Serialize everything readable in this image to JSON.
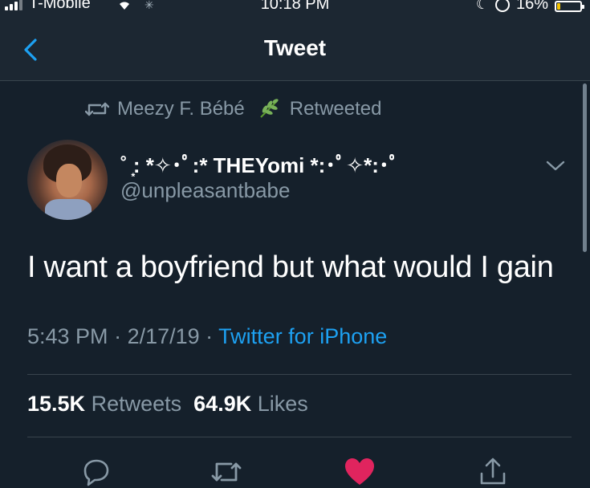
{
  "status_bar": {
    "carrier": "T-Mobile",
    "time": "10:18 PM",
    "battery": "16%",
    "battery_level": 0.16,
    "icons": [
      "signal-icon",
      "wifi-icon",
      "activity-spinner-icon",
      "moon-icon",
      "rotation-lock-icon",
      "battery-icon"
    ]
  },
  "nav": {
    "title": "Tweet",
    "back_icon": "chevron-left-icon"
  },
  "retweet_context": {
    "name": "Meezy F. Bébé",
    "emoji": "herb",
    "label": "Retweeted"
  },
  "author": {
    "display_name": "˚ ͙: *✧･ﾟ:* THEYomi *:･ﾟ✧*:･ﾟ",
    "handle": "@unpleasantbabe"
  },
  "tweet": {
    "text": "I want a boyfriend but what would I gain",
    "time": "5:43 PM",
    "date": "2/17/19",
    "source": "Twitter for iPhone"
  },
  "stats": {
    "retweets_count": "15.5K",
    "retweets_label": "Retweets",
    "likes_count": "64.9K",
    "likes_label": "Likes"
  },
  "actions": [
    "reply-icon",
    "retweet-icon",
    "like-icon",
    "share-icon"
  ],
  "colors": {
    "background": "#15202b",
    "header": "#1c2732",
    "secondary_text": "#8899a6",
    "accent": "#1da1f2",
    "like": "#e0245e",
    "divider": "#38444d"
  }
}
